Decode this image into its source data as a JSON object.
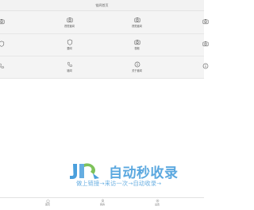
{
  "header": {
    "title": "链闻首页"
  },
  "grid": {
    "row1": [
      {
        "label": "",
        "icon": "camera-icon"
      },
      {
        "label": "视觉链闻",
        "icon": "camera-icon"
      },
      {
        "label": "视觉链闻",
        "icon": "camera-icon"
      },
      {
        "label": "",
        "icon": "camera-icon"
      }
    ],
    "row2": [
      {
        "label": "",
        "icon": "shield-icon"
      },
      {
        "label": "要闻",
        "icon": "shield-icon"
      },
      {
        "label": "视频",
        "icon": "camera-icon"
      },
      {
        "label": "",
        "icon": "camera-icon"
      }
    ],
    "row3": [
      {
        "label": "",
        "icon": "phone-icon"
      },
      {
        "label": "链闻",
        "icon": "phone-icon"
      },
      {
        "label": "关于链闻",
        "icon": "info-icon"
      },
      {
        "label": "",
        "icon": "info-icon"
      }
    ]
  },
  "watermark": {
    "title": "自动秒收录",
    "subtitle": "做上链接→来访一次→自动收录→"
  },
  "tabbar": {
    "tabs": [
      {
        "label": "首页",
        "icon": "home-icon"
      },
      {
        "label": "我的",
        "icon": "user-icon"
      },
      {
        "label": "设置",
        "icon": "settings-icon"
      }
    ]
  },
  "colors": {
    "accent": "#4a9fdc",
    "header_bg": "#f2f2f2",
    "grid_bg": "#f4f4f4"
  }
}
